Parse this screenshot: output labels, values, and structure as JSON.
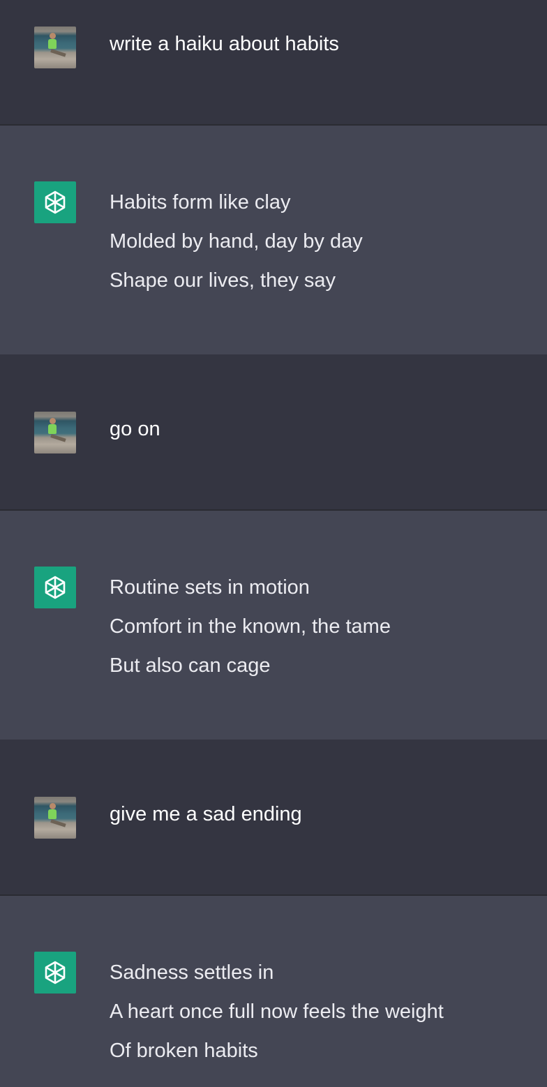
{
  "conversation": {
    "messages": [
      {
        "role": "user",
        "avatar": "user-photo",
        "text": "write a haiku about habits"
      },
      {
        "role": "assistant",
        "avatar": "openai-logo-icon",
        "lines": [
          "Habits form like clay",
          "Molded by hand, day by day",
          "Shape our lives, they say"
        ]
      },
      {
        "role": "user",
        "avatar": "user-photo",
        "text": "go on"
      },
      {
        "role": "assistant",
        "avatar": "openai-logo-icon",
        "lines": [
          "Routine sets in motion",
          "Comfort in the known, the tame",
          "But also can cage"
        ]
      },
      {
        "role": "user",
        "avatar": "user-photo",
        "text": "give me a sad ending"
      },
      {
        "role": "assistant",
        "avatar": "openai-logo-icon",
        "lines": [
          "Sadness settles in",
          "A heart once full now feels the weight",
          "Of broken habits"
        ]
      }
    ]
  },
  "colors": {
    "user_bg": "#343541",
    "assistant_bg": "#444654",
    "bot_avatar": "#19a37f",
    "text": "#ececf1"
  }
}
